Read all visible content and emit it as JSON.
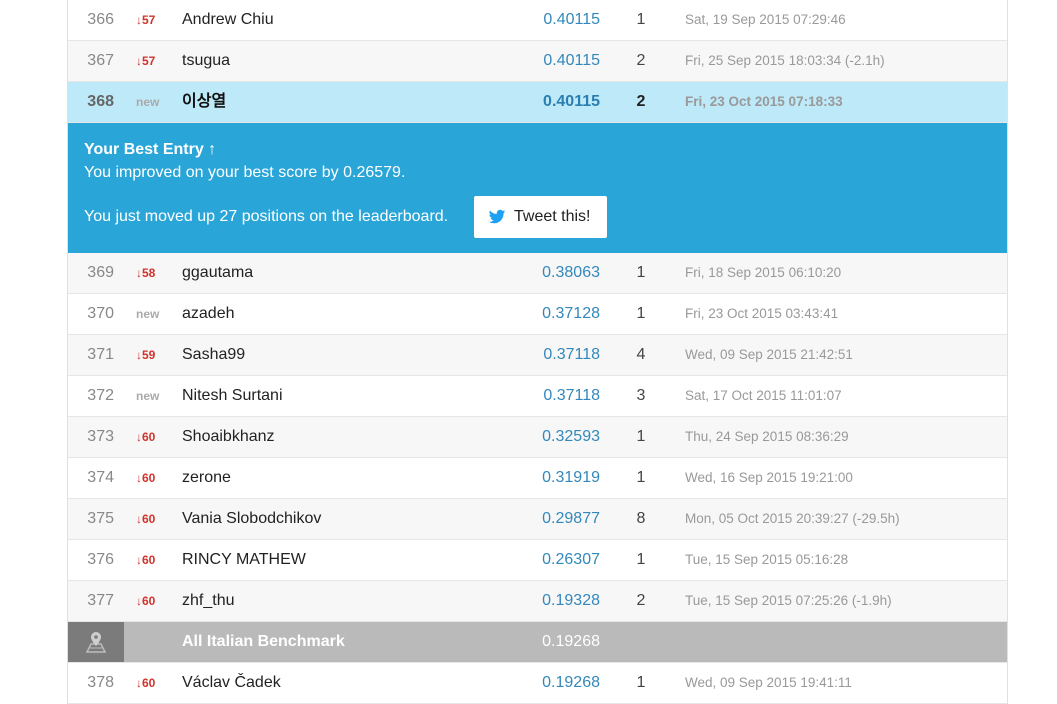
{
  "rows_top": [
    {
      "rank": "366",
      "delta": "↓57",
      "new": false,
      "name": "Andrew Chiu",
      "score": "0.40115",
      "entries": "1",
      "last": "Sat, 19 Sep 2015 07:29:46"
    },
    {
      "rank": "367",
      "delta": "↓57",
      "new": false,
      "name": "tsugua",
      "score": "0.40115",
      "entries": "2",
      "last": "Fri, 25 Sep 2015 18:03:34 (-2.1h)"
    }
  ],
  "highlight_row": {
    "rank": "368",
    "delta": "new",
    "name": "이상열",
    "score": "0.40115",
    "entries": "2",
    "last": "Fri, 23 Oct 2015 07:18:33"
  },
  "banner": {
    "title": "Your Best Entry ↑",
    "improved": "You improved on your best score by 0.26579.",
    "moved": "You just moved up 27 positions on the leaderboard.",
    "tweet_label": "Tweet this!"
  },
  "rows_bottom": [
    {
      "rank": "369",
      "delta": "↓58",
      "name": "ggautama",
      "score": "0.38063",
      "entries": "1",
      "last": "Fri, 18 Sep 2015 06:10:20"
    },
    {
      "rank": "370",
      "delta": "new",
      "name": "azadeh",
      "score": "0.37128",
      "entries": "1",
      "last": "Fri, 23 Oct 2015 03:43:41"
    },
    {
      "rank": "371",
      "delta": "↓59",
      "name": "Sasha99",
      "score": "0.37118",
      "entries": "4",
      "last": "Wed, 09 Sep 2015 21:42:51"
    },
    {
      "rank": "372",
      "delta": "new",
      "name": "Nitesh Surtani",
      "score": "0.37118",
      "entries": "3",
      "last": "Sat, 17 Oct 2015 11:01:07"
    },
    {
      "rank": "373",
      "delta": "↓60",
      "name": "Shoaibkhanz",
      "score": "0.32593",
      "entries": "1",
      "last": "Thu, 24 Sep 2015 08:36:29"
    },
    {
      "rank": "374",
      "delta": "↓60",
      "name": "zerone",
      "score": "0.31919",
      "entries": "1",
      "last": "Wed, 16 Sep 2015 19:21:00"
    },
    {
      "rank": "375",
      "delta": "↓60",
      "name": "Vania Slobodchikov",
      "score": "0.29877",
      "entries": "8",
      "last": "Mon, 05 Oct 2015 20:39:27 (-29.5h)"
    },
    {
      "rank": "376",
      "delta": "↓60",
      "name": "RINCY MATHEW",
      "score": "0.26307",
      "entries": "1",
      "last": "Tue, 15 Sep 2015 05:16:28"
    },
    {
      "rank": "377",
      "delta": "↓60",
      "name": "zhf_thu",
      "score": "0.19328",
      "entries": "2",
      "last": "Tue, 15 Sep 2015 07:25:26 (-1.9h)"
    }
  ],
  "benchmark": {
    "name": "All Italian Benchmark",
    "score": "0.19268",
    "icon": "map-pin-icon"
  },
  "rows_after": [
    {
      "rank": "378",
      "delta": "↓60",
      "name": "Václav Čadek",
      "score": "0.19268",
      "entries": "1",
      "last": "Wed, 09 Sep 2015 19:41:11"
    }
  ],
  "colors": {
    "highlight_bg": "#bde9f8",
    "banner_bg": "#2aa5d8",
    "score_text": "#3388bb",
    "delta_down": "#d0332b",
    "benchmark_bg": "#bababa",
    "benchmark_icon_bg": "#7b7b7b",
    "twitter_blue": "#1da1f2"
  }
}
